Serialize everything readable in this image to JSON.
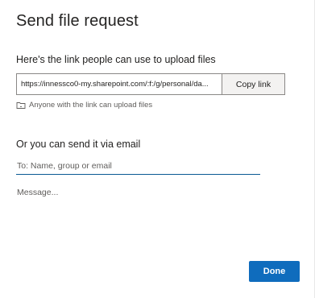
{
  "dialog": {
    "title": "Send file request",
    "link_heading": "Here's the link people can use to upload files",
    "link_value": "https://innessco0-my.sharepoint.com/:f:/g/personal/da...",
    "copy_button_label": "Copy link",
    "permission_icon": "folder-link-icon",
    "permission_text": "Anyone with the link can upload files",
    "email_heading": "Or you can send it via email",
    "to_placeholder": "To: Name, group or email",
    "to_value": "",
    "message_placeholder": "Message...",
    "message_value": "",
    "done_button_label": "Done"
  },
  "colors": {
    "primary": "#0f6cbd",
    "input_underline": "#0a5a93",
    "secondary_text": "#605e5c"
  }
}
